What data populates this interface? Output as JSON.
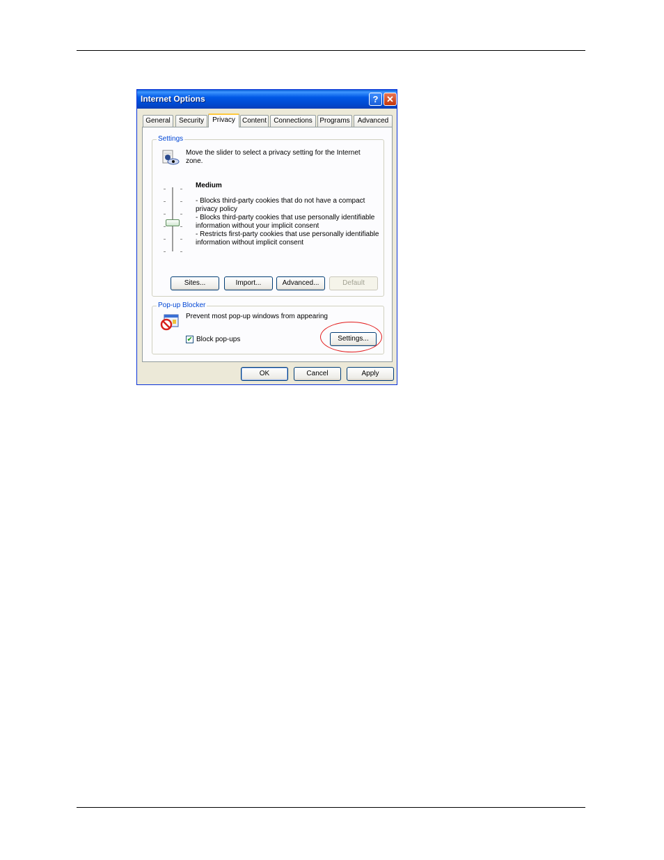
{
  "dialog": {
    "title": "Internet Options",
    "help_symbol": "?",
    "close_symbol": "✕"
  },
  "tabs": [
    {
      "label": "General"
    },
    {
      "label": "Security"
    },
    {
      "label": "Privacy"
    },
    {
      "label": "Content"
    },
    {
      "label": "Connections"
    },
    {
      "label": "Programs"
    },
    {
      "label": "Advanced"
    }
  ],
  "active_tab": "Privacy",
  "settings": {
    "group_label": "Settings",
    "intro_line1": "Move the slider to select a privacy setting for the Internet",
    "intro_line2": "zone.",
    "level": "Medium",
    "lines": [
      "- Blocks third-party cookies that do not have a compact",
      "privacy policy",
      "- Blocks third-party cookies that use personally identifiable",
      "information without your implicit consent",
      "- Restricts first-party cookies that use personally identifiable",
      "information without implicit consent"
    ],
    "buttons": {
      "sites": "Sites...",
      "import": "Import...",
      "advanced": "Advanced...",
      "default": "Default"
    }
  },
  "popup": {
    "group_label": "Pop-up Blocker",
    "description": "Prevent most pop-up windows from appearing",
    "checkbox_label": "Block pop-ups",
    "checkbox_checked": true,
    "check_mark": "✔",
    "settings_button": "Settings..."
  },
  "footer": {
    "ok": "OK",
    "cancel": "Cancel",
    "apply": "Apply"
  },
  "icons": {
    "privacy": "privacy-person-icon",
    "popup": "popup-blocker-icon"
  },
  "colors": {
    "accent": "#0046d5",
    "annotation": "#e21a1a",
    "titlebar": "#0058e6"
  }
}
